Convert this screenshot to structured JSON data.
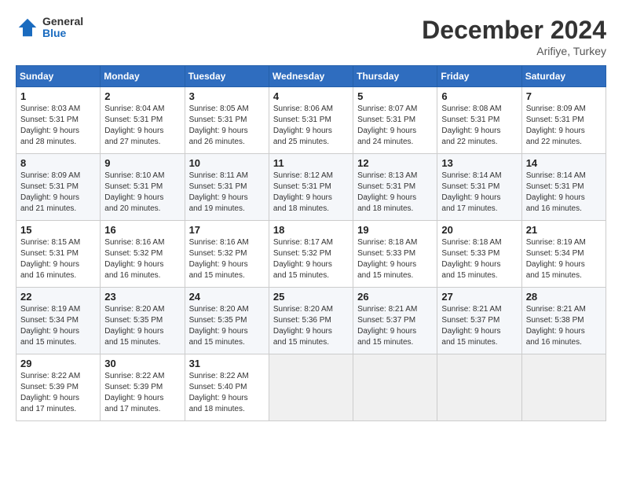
{
  "header": {
    "logo_general": "General",
    "logo_blue": "Blue",
    "month_title": "December 2024",
    "location": "Arifiye, Turkey"
  },
  "days_of_week": [
    "Sunday",
    "Monday",
    "Tuesday",
    "Wednesday",
    "Thursday",
    "Friday",
    "Saturday"
  ],
  "weeks": [
    [
      {
        "day": "1",
        "sunrise": "8:03 AM",
        "sunset": "5:31 PM",
        "daylight_hours": "9",
        "daylight_minutes": "28"
      },
      {
        "day": "2",
        "sunrise": "8:04 AM",
        "sunset": "5:31 PM",
        "daylight_hours": "9",
        "daylight_minutes": "27"
      },
      {
        "day": "3",
        "sunrise": "8:05 AM",
        "sunset": "5:31 PM",
        "daylight_hours": "9",
        "daylight_minutes": "26"
      },
      {
        "day": "4",
        "sunrise": "8:06 AM",
        "sunset": "5:31 PM",
        "daylight_hours": "9",
        "daylight_minutes": "25"
      },
      {
        "day": "5",
        "sunrise": "8:07 AM",
        "sunset": "5:31 PM",
        "daylight_hours": "9",
        "daylight_minutes": "24"
      },
      {
        "day": "6",
        "sunrise": "8:08 AM",
        "sunset": "5:31 PM",
        "daylight_hours": "9",
        "daylight_minutes": "22"
      },
      {
        "day": "7",
        "sunrise": "8:09 AM",
        "sunset": "5:31 PM",
        "daylight_hours": "9",
        "daylight_minutes": "22"
      }
    ],
    [
      {
        "day": "8",
        "sunrise": "8:09 AM",
        "sunset": "5:31 PM",
        "daylight_hours": "9",
        "daylight_minutes": "21"
      },
      {
        "day": "9",
        "sunrise": "8:10 AM",
        "sunset": "5:31 PM",
        "daylight_hours": "9",
        "daylight_minutes": "20"
      },
      {
        "day": "10",
        "sunrise": "8:11 AM",
        "sunset": "5:31 PM",
        "daylight_hours": "9",
        "daylight_minutes": "19"
      },
      {
        "day": "11",
        "sunrise": "8:12 AM",
        "sunset": "5:31 PM",
        "daylight_hours": "9",
        "daylight_minutes": "18"
      },
      {
        "day": "12",
        "sunrise": "8:13 AM",
        "sunset": "5:31 PM",
        "daylight_hours": "9",
        "daylight_minutes": "18"
      },
      {
        "day": "13",
        "sunrise": "8:14 AM",
        "sunset": "5:31 PM",
        "daylight_hours": "9",
        "daylight_minutes": "17"
      },
      {
        "day": "14",
        "sunrise": "8:14 AM",
        "sunset": "5:31 PM",
        "daylight_hours": "9",
        "daylight_minutes": "16"
      }
    ],
    [
      {
        "day": "15",
        "sunrise": "8:15 AM",
        "sunset": "5:31 PM",
        "daylight_hours": "9",
        "daylight_minutes": "16"
      },
      {
        "day": "16",
        "sunrise": "8:16 AM",
        "sunset": "5:32 PM",
        "daylight_hours": "9",
        "daylight_minutes": "16"
      },
      {
        "day": "17",
        "sunrise": "8:16 AM",
        "sunset": "5:32 PM",
        "daylight_hours": "9",
        "daylight_minutes": "15"
      },
      {
        "day": "18",
        "sunrise": "8:17 AM",
        "sunset": "5:32 PM",
        "daylight_hours": "9",
        "daylight_minutes": "15"
      },
      {
        "day": "19",
        "sunrise": "8:18 AM",
        "sunset": "5:33 PM",
        "daylight_hours": "9",
        "daylight_minutes": "15"
      },
      {
        "day": "20",
        "sunrise": "8:18 AM",
        "sunset": "5:33 PM",
        "daylight_hours": "9",
        "daylight_minutes": "15"
      },
      {
        "day": "21",
        "sunrise": "8:19 AM",
        "sunset": "5:34 PM",
        "daylight_hours": "9",
        "daylight_minutes": "15"
      }
    ],
    [
      {
        "day": "22",
        "sunrise": "8:19 AM",
        "sunset": "5:34 PM",
        "daylight_hours": "9",
        "daylight_minutes": "15"
      },
      {
        "day": "23",
        "sunrise": "8:20 AM",
        "sunset": "5:35 PM",
        "daylight_hours": "9",
        "daylight_minutes": "15"
      },
      {
        "day": "24",
        "sunrise": "8:20 AM",
        "sunset": "5:35 PM",
        "daylight_hours": "9",
        "daylight_minutes": "15"
      },
      {
        "day": "25",
        "sunrise": "8:20 AM",
        "sunset": "5:36 PM",
        "daylight_hours": "9",
        "daylight_minutes": "15"
      },
      {
        "day": "26",
        "sunrise": "8:21 AM",
        "sunset": "5:37 PM",
        "daylight_hours": "9",
        "daylight_minutes": "15"
      },
      {
        "day": "27",
        "sunrise": "8:21 AM",
        "sunset": "5:37 PM",
        "daylight_hours": "9",
        "daylight_minutes": "15"
      },
      {
        "day": "28",
        "sunrise": "8:21 AM",
        "sunset": "5:38 PM",
        "daylight_hours": "9",
        "daylight_minutes": "16"
      }
    ],
    [
      {
        "day": "29",
        "sunrise": "8:22 AM",
        "sunset": "5:39 PM",
        "daylight_hours": "9",
        "daylight_minutes": "17"
      },
      {
        "day": "30",
        "sunrise": "8:22 AM",
        "sunset": "5:39 PM",
        "daylight_hours": "9",
        "daylight_minutes": "17"
      },
      {
        "day": "31",
        "sunrise": "8:22 AM",
        "sunset": "5:40 PM",
        "daylight_hours": "9",
        "daylight_minutes": "18"
      },
      null,
      null,
      null,
      null
    ]
  ]
}
